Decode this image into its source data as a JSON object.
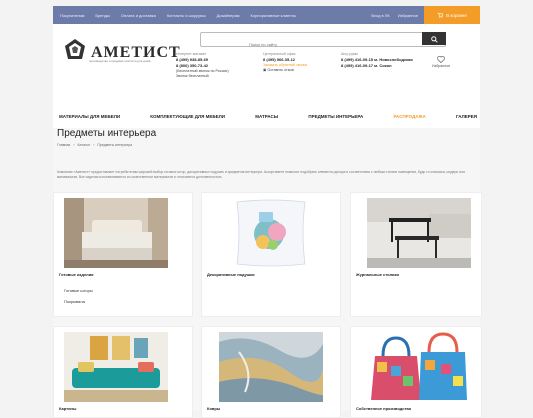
{
  "topbar": {
    "links": [
      "Покупателям",
      "Бренды",
      "Оплата и доставка",
      "Контакты и шоурумы",
      "Дизайнерам",
      "Корпоративные клиенты"
    ],
    "account": "Вход в ЛК",
    "wishlist": "Избранное",
    "cart_label": "В корзине"
  },
  "brand": {
    "name": "АМЕТИСТ",
    "tagline": "производство и продажа текстиля для дома"
  },
  "search": {
    "placeholder": "Поиск по сайту"
  },
  "contacts": [
    {
      "label": "Интернет-магазин",
      "phones": [
        "8 (499) 938-85-69",
        "8 (800) 350-73-42"
      ],
      "notes": [
        "(Бесплатный звонок по России)",
        "Звонок бесплатный"
      ]
    },
    {
      "label": "Центральный офис",
      "phones": [
        "8 (495) 966-35-12"
      ],
      "highlight": "Заказать обратный звонок",
      "extra": "Оставить отзыв"
    },
    {
      "label": "Шоу-румы",
      "phones": [
        "8 (499) 416-09-15 м. Новослободская",
        "8 (499) 416-09-17 м. Сокол"
      ]
    }
  ],
  "favorites_label": "Избранное",
  "nav": [
    "МАТЕРИАЛЫ ДЛЯ МЕБЕЛИ",
    "КОМПЛЕКТУЮЩИЕ ДЛЯ МЕБЕЛИ",
    "МАТРАСЫ",
    "ПРЕДМЕТЫ ИНТЕРЬЕРА",
    "РАСПРОДАЖА",
    "ГАЛЕРЕЯ"
  ],
  "page": {
    "title": "Предметы интерьера",
    "breadcrumbs": [
      "Главная",
      "Каталог",
      "Предметы интерьера"
    ],
    "description": "Компания «Аметист» предоставляет потребителям широкий выбор готовых штор, декоративных подушек и предметов интерьера. Ассортимент позволит подобрать элементы декора в соответствии с любым стилем помещения, будь то классика, модерн или минимализм. Все изделия изготавливаются из качественных материалов и отличаются долговечностью."
  },
  "cards": [
    {
      "title": "Готовые изделия",
      "subitems": [
        "Готовые шторы",
        "Покрывала"
      ]
    },
    {
      "title": "Декоративные подушки",
      "subitems": []
    },
    {
      "title": "Журнальные столики",
      "subitems": []
    },
    {
      "title": "Картины",
      "subitems": []
    },
    {
      "title": "Ковры",
      "subitems": []
    },
    {
      "title": "Собственное производство",
      "subitems": []
    }
  ],
  "colors": {
    "topbar": "#6c7ba8",
    "accent": "#f39c28",
    "background": "#f3f3f3"
  }
}
